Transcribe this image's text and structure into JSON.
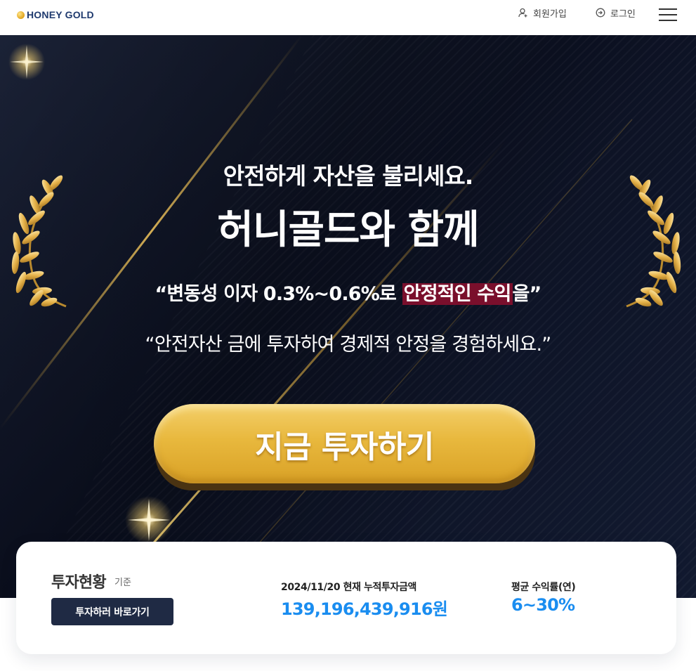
{
  "header": {
    "logo_text": "HONEY GOLD",
    "join_label": "회원가입",
    "login_label": "로그인"
  },
  "hero": {
    "title_line1": "안전하게 자산을 불리세요.",
    "title_line2": "허니골드와 함께",
    "quote1_prefix": "“변동성 이자 0.3%~0.6%로 ",
    "quote1_highlight": "안정적인 수익",
    "quote1_suffix": "을”",
    "quote2": "“안전자산 금에 투자하여 경제적 안정을 경험하세요.”",
    "cta_label": "지금 투자하기",
    "highlight_color": "#7a0f2c"
  },
  "status": {
    "title": "투자현황",
    "subtitle": "기준",
    "button_label": "투자하러 바로가기",
    "total_label": "2024/11/20 현재 누적투자금액",
    "total_value": "139,196,439,916원",
    "rate_label": "평균 수익률(연)",
    "rate_value": "6~30%",
    "accent_color": "#1a8df0"
  },
  "icons": {
    "join": "user-plus-icon",
    "login": "login-icon",
    "menu": "hamburger-menu-icon",
    "laurel": "laurel-wreath-icon"
  }
}
